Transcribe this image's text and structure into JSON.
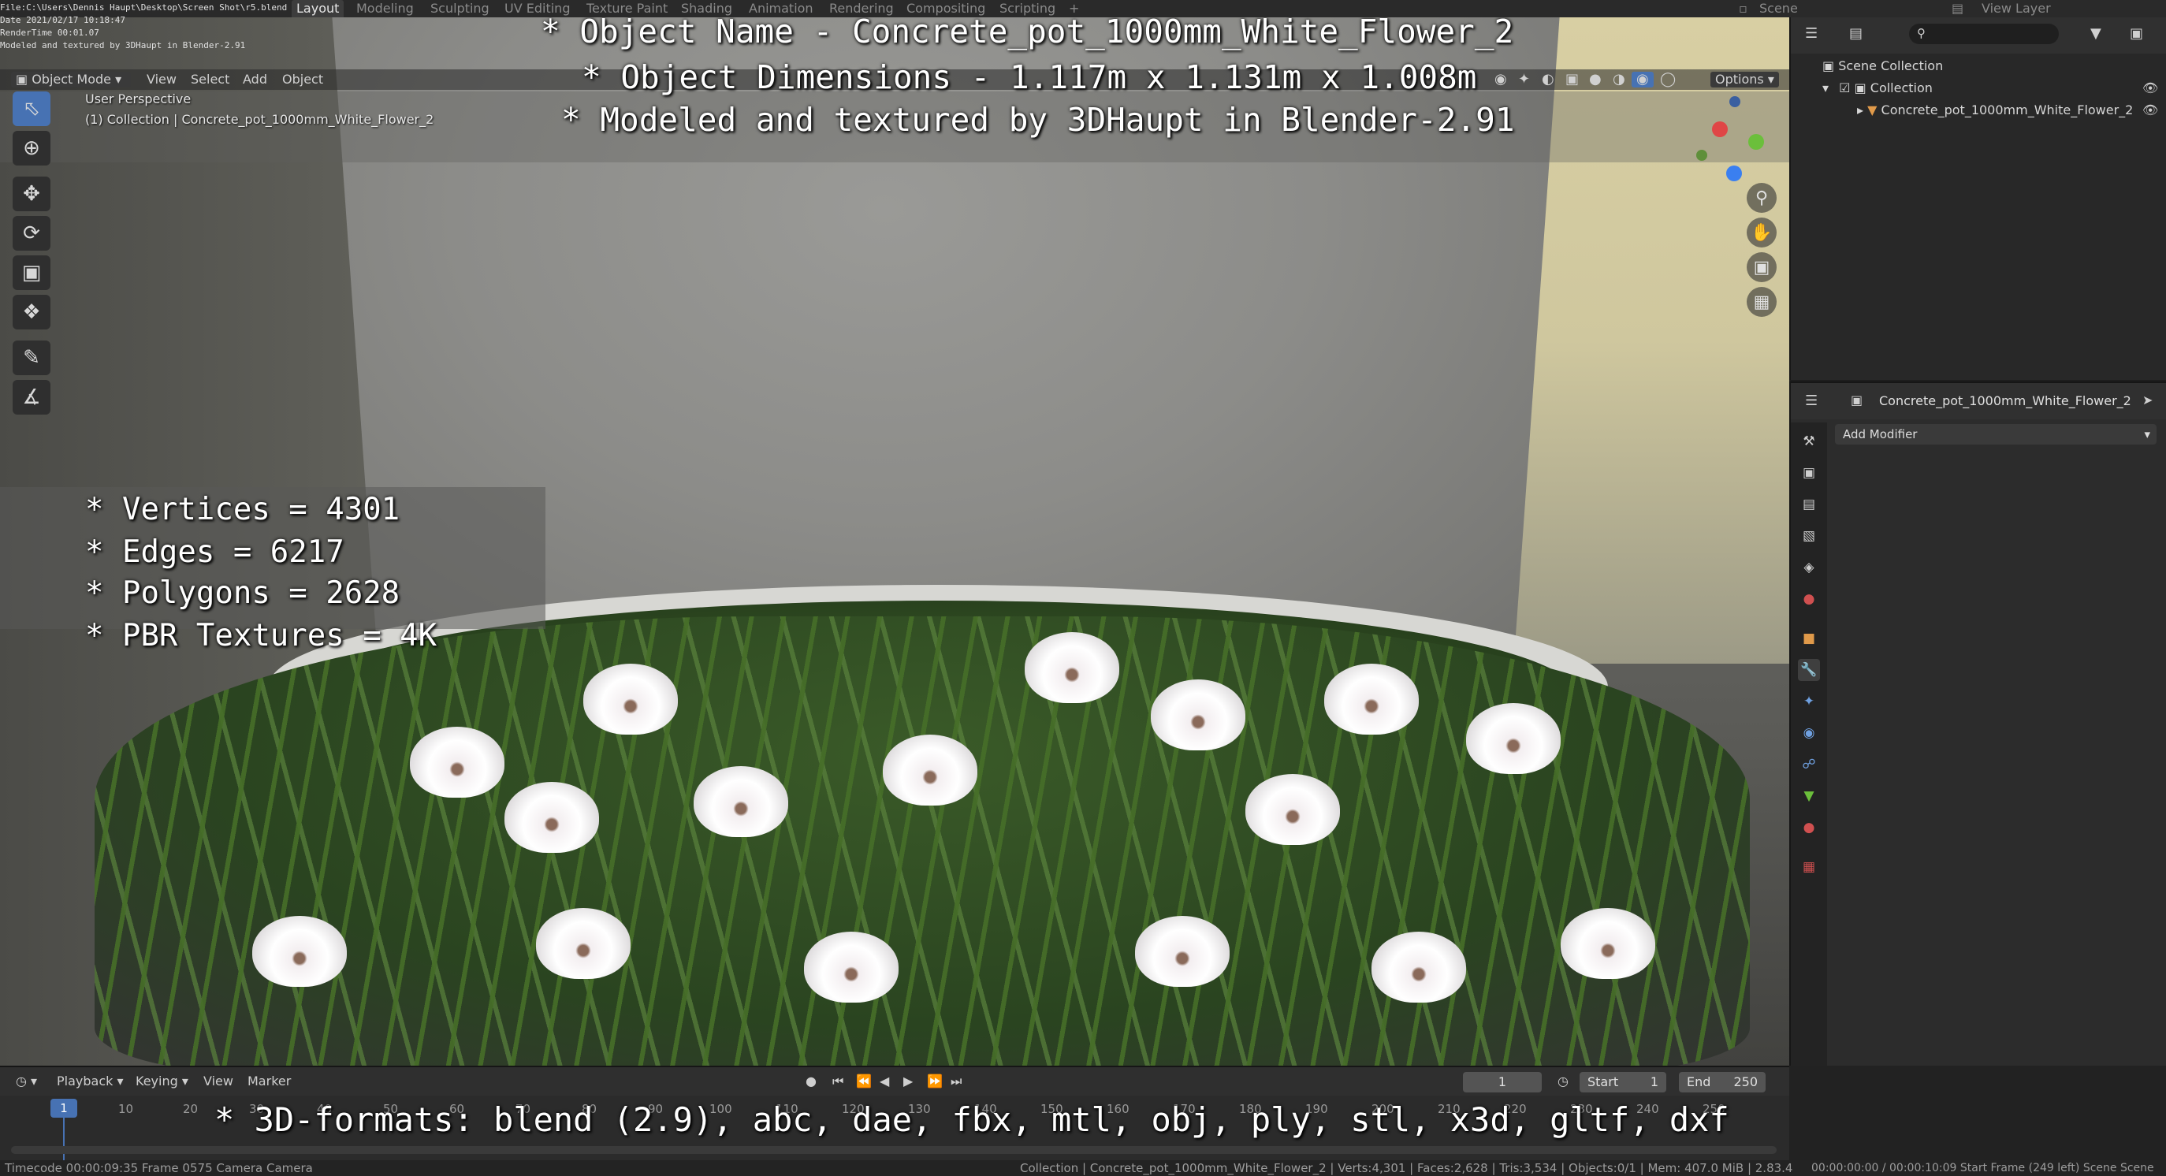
{
  "topbar": {
    "tabs": [
      "Layout",
      "Modeling",
      "Sculpting",
      "UV Editing",
      "Texture Paint",
      "Shading",
      "Animation",
      "Rendering",
      "Compositing",
      "Scripting",
      "+"
    ],
    "scene_label": "Scene",
    "view_layer_label": "View Layer"
  },
  "render_info": {
    "file": "File:C:\\Users\\Dennis Haupt\\Desktop\\Screen Shot\\r5.blend",
    "date": "Date 2021/02/17 10:18:47",
    "rendertime": "RenderTime 00:01.07",
    "credit": "Modeled and textured by 3DHaupt in Blender-2.91"
  },
  "viewport_header": {
    "mode": "Object Mode",
    "menu": [
      "View",
      "Select",
      "Add",
      "Object"
    ],
    "options": "Options"
  },
  "viewport_info": {
    "perspective": "User Perspective",
    "collection_line": "(1) Collection | Concrete_pot_1000mm_White_Flower_2"
  },
  "overlay_title": {
    "line1": "* Object Name - Concrete_pot_1000mm_White_Flower_2",
    "line2": "* Object Dimensions -  1.117m x 1.131m x 1.008m",
    "line3": "* Modeled and textured by 3DHaupt in Blender-2.91"
  },
  "stats": {
    "vertices": "* Vertices = 4301",
    "edges": "* Edges = 6217",
    "polygons": "* Polygons = 2628",
    "textures": "* PBR Textures = 4K"
  },
  "formats": "* 3D-formats: blend (2.9), abc, dae, fbx, mtl, obj, ply, stl, x3d, gltf, dxf",
  "outliner": {
    "scene_collection": "Scene Collection",
    "collection": "Collection",
    "object": "Concrete_pot_1000mm_White_Flower_2"
  },
  "properties": {
    "object_name": "Concrete_pot_1000mm_White_Flower_2",
    "add_modifier": "Add Modifier"
  },
  "timeline": {
    "menu": [
      "Playback",
      "Keying",
      "View",
      "Marker"
    ],
    "current_frame": "1",
    "start_label": "Start",
    "start_value": "1",
    "end_label": "End",
    "end_value": "250",
    "ticks": [
      "1",
      "10",
      "20",
      "30",
      "40",
      "50",
      "60",
      "70",
      "80",
      "90",
      "100",
      "110",
      "120",
      "130",
      "140",
      "150",
      "160",
      "170",
      "180",
      "190",
      "200",
      "210",
      "220",
      "230",
      "240",
      "250"
    ]
  },
  "statusbar": {
    "left": "Timecode 00:00:09:35   Frame 0575   Camera Camera",
    "center": "Collection | Concrete_pot_1000mm_White_Flower_2 | Verts:4,301 | Faces:2,628 | Tris:3,534 | Objects:0/1 | Mem: 407.0 MiB | 2.83.4",
    "right": "00:00:00:00 / 00:00:10:09     Start Frame (249 left)   Scene  Scene"
  },
  "colors": {
    "accent": "#4772b3",
    "panel": "#2c2c2c",
    "overlay_text": "#ffffff"
  }
}
